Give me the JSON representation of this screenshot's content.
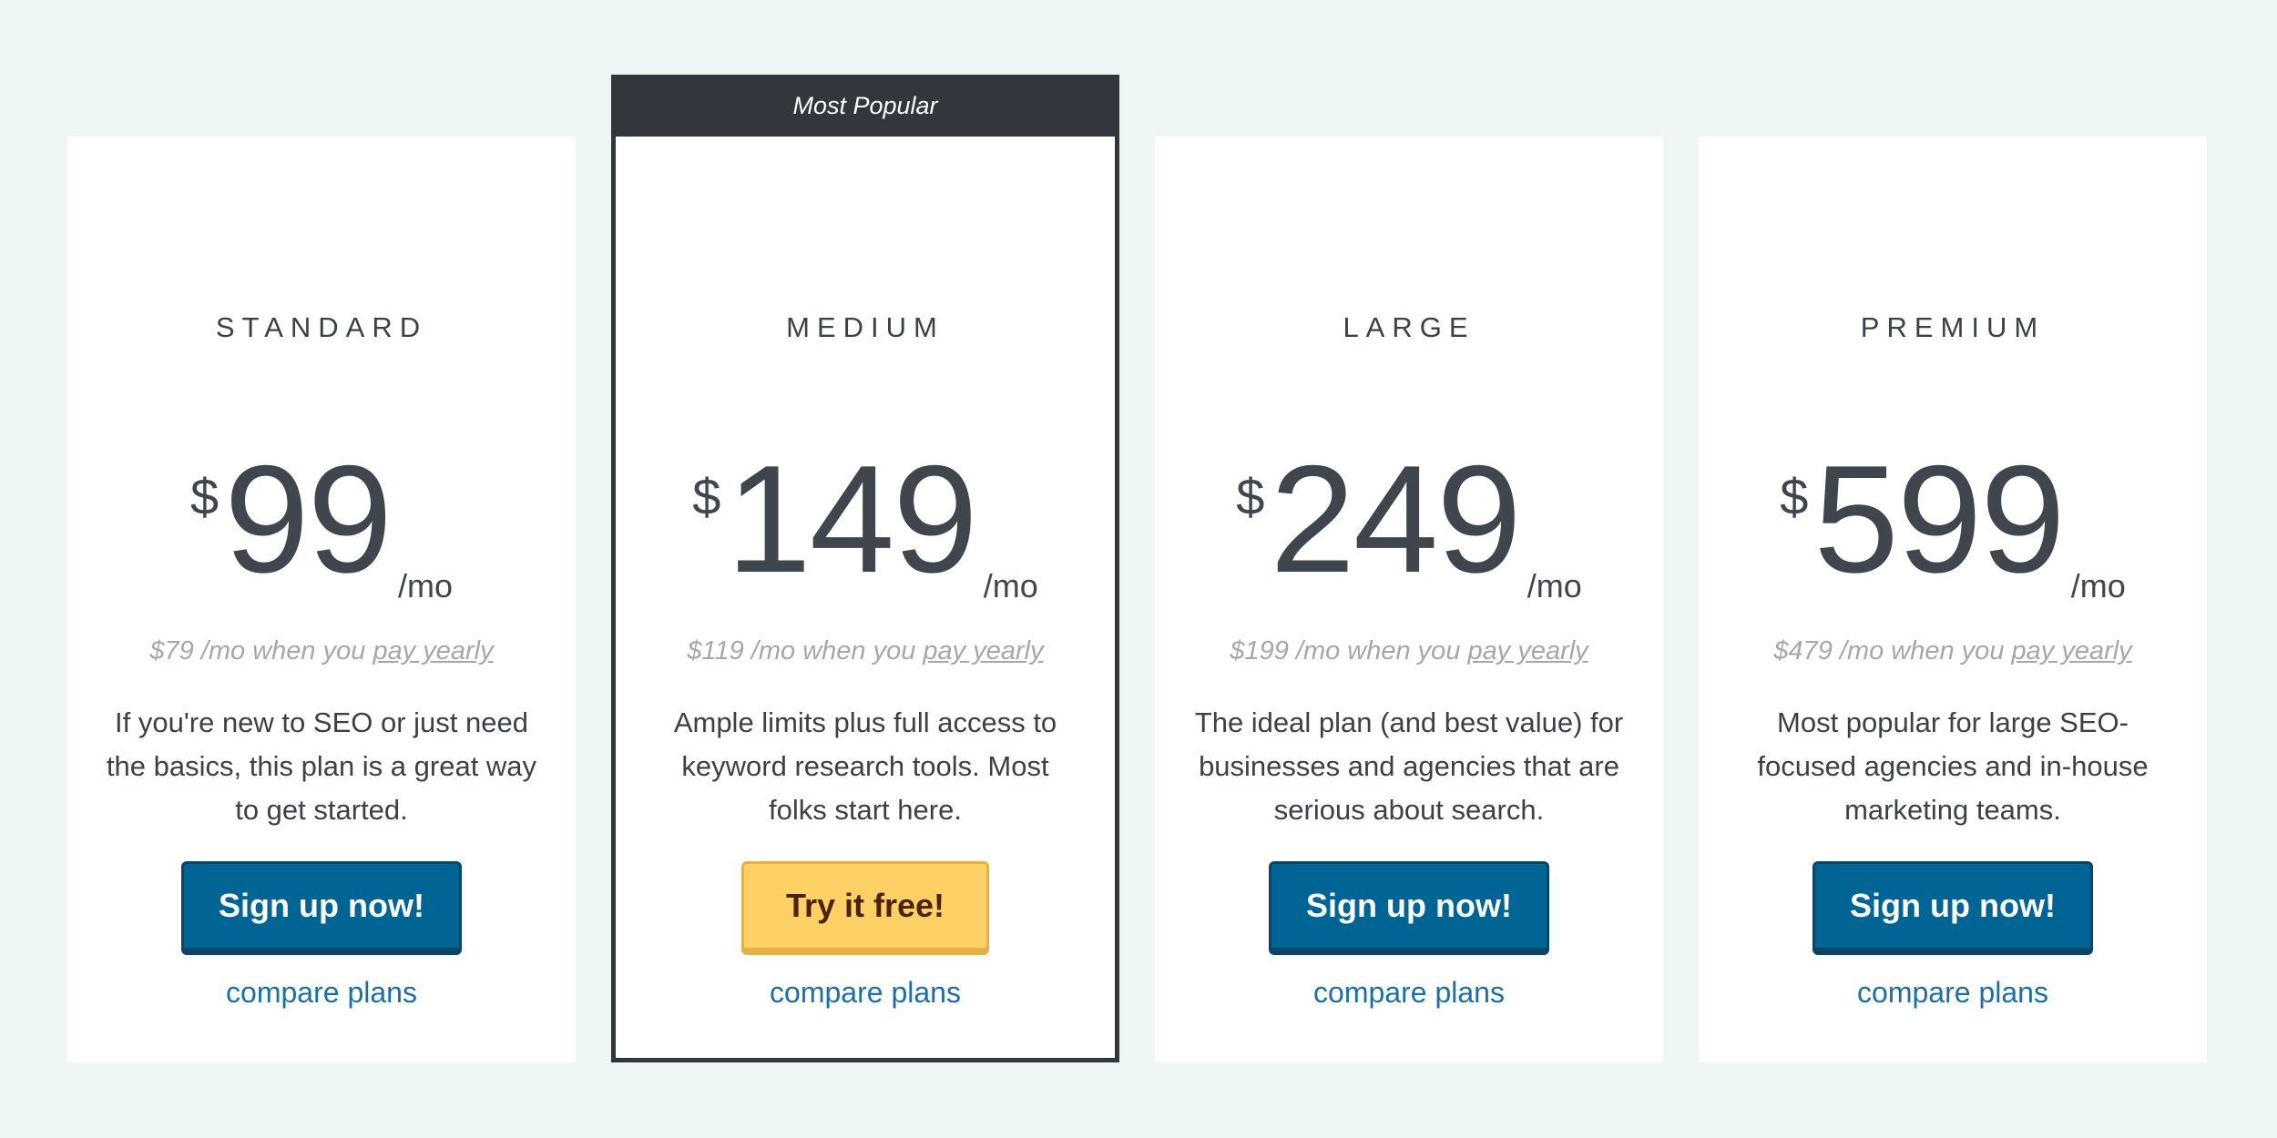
{
  "colors": {
    "background": "#eef7f6",
    "card": "#ffffff",
    "featured_border": "#32363d",
    "primary_button": "#006494",
    "free_button": "#fdd166",
    "link": "#1a6fa8"
  },
  "plans": [
    {
      "name": "STANDARD",
      "currency": "$",
      "price": "99",
      "per": "/mo",
      "yearly_prefix": "$79 /mo when you ",
      "yearly_link": "pay yearly",
      "description": "If you're new to SEO or just need the basics, this plan is a great way to get started.",
      "button_label": "Sign up now!",
      "compare_label": "compare plans"
    },
    {
      "ribbon": "Most Popular",
      "name": "MEDIUM",
      "currency": "$",
      "price": "149",
      "per": "/mo",
      "yearly_prefix": "$119 /mo when you ",
      "yearly_link": "pay yearly",
      "description": "Ample limits plus full access to keyword research tools. Most folks start here.",
      "button_label": "Try it free!",
      "compare_label": "compare plans"
    },
    {
      "name": "LARGE",
      "currency": "$",
      "price": "249",
      "per": "/mo",
      "yearly_prefix": "$199 /mo when you ",
      "yearly_link": "pay yearly",
      "description": "The ideal plan (and best value) for businesses and agencies that are serious about search.",
      "button_label": "Sign up now!",
      "compare_label": "compare plans"
    },
    {
      "name": "PREMIUM",
      "currency": "$",
      "price": "599",
      "per": "/mo",
      "yearly_prefix": "$479 /mo when you ",
      "yearly_link": "pay yearly",
      "description": "Most popular for large SEO-focused agencies and in-house marketing teams.",
      "button_label": "Sign up now!",
      "compare_label": "compare plans"
    }
  ]
}
